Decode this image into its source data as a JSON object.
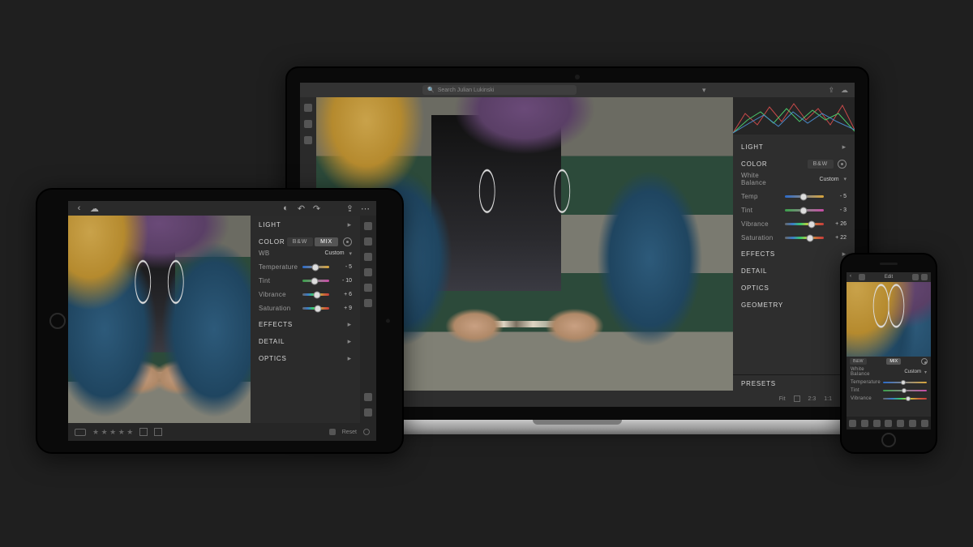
{
  "laptop": {
    "search_placeholder": "Search Julian Lukinski",
    "panels": {
      "light": {
        "title": "LIGHT"
      },
      "color": {
        "title": "COLOR",
        "tab_bw": "B&W",
        "eyedrop": "eyedrop"
      },
      "effects": {
        "title": "EFFECTS"
      },
      "detail": {
        "title": "DETAIL"
      },
      "optics": {
        "title": "OPTICS"
      },
      "geometry": {
        "title": "GEOMETRY"
      }
    },
    "wb": {
      "label": "White Balance",
      "value": "Custom"
    },
    "sliders": {
      "temp": {
        "label": "Temp",
        "value": "- 5",
        "pos": 47
      },
      "tint": {
        "label": "Tint",
        "value": "- 3",
        "pos": 48
      },
      "vibrance": {
        "label": "Vibrance",
        "value": "+ 26",
        "pos": 68
      },
      "saturation": {
        "label": "Saturation",
        "value": "+ 22",
        "pos": 65
      }
    },
    "bottom": {
      "fit": "Fit",
      "ratio_a": "2:3",
      "ratio_b": "1:1",
      "presets": "Presets"
    }
  },
  "tablet": {
    "panels": {
      "light": {
        "title": "LIGHT"
      },
      "color": {
        "title": "COLOR",
        "tab_bw": "B&W",
        "tab_mix": "MIX"
      },
      "effects": {
        "title": "EFFECTS"
      },
      "detail": {
        "title": "DETAIL"
      },
      "optics": {
        "title": "OPTICS"
      }
    },
    "wb": {
      "label": "WB",
      "value": "Custom"
    },
    "sliders": {
      "temperature": {
        "label": "Temperature",
        "value": "- 5",
        "pos": 47
      },
      "tint": {
        "label": "Tint",
        "value": "- 10",
        "pos": 44
      },
      "vibrance": {
        "label": "Vibrance",
        "value": "+ 6",
        "pos": 55
      },
      "saturation": {
        "label": "Saturation",
        "value": "+ 9",
        "pos": 57
      }
    },
    "reset": "Reset"
  },
  "phone": {
    "edit": "Edit",
    "tab_bw": "B&W",
    "tab_mix": "MIX",
    "wb": {
      "label": "White Balance",
      "value": "Custom"
    },
    "sliders": {
      "temperature": {
        "label": "Temperature",
        "pos": 47
      },
      "tint": {
        "label": "Tint",
        "pos": 48
      },
      "vibrance": {
        "label": "Vibrance",
        "pos": 58
      }
    }
  }
}
